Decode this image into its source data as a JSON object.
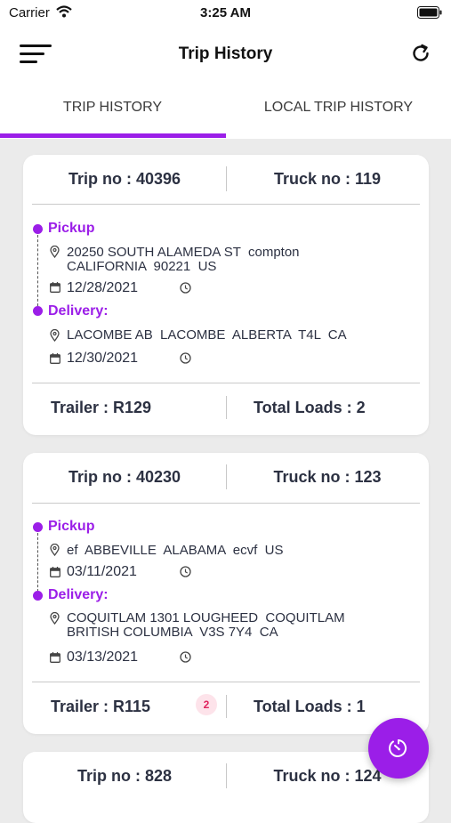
{
  "status_bar": {
    "carrier": "Carrier",
    "time": "3:25 AM"
  },
  "header": {
    "title": "Trip History"
  },
  "tabs": [
    {
      "label": "TRIP HISTORY",
      "active": true
    },
    {
      "label": "LOCAL TRIP HISTORY",
      "active": false
    }
  ],
  "colors": {
    "accent": "#9b1ee8",
    "badge_bg": "#fde3ea",
    "badge_text": "#e0245e",
    "text": "#2c3142"
  },
  "trips": [
    {
      "trip_no": "Trip no : 40396",
      "truck_no": "Truck no : 119",
      "pickup_label": "Pickup",
      "pickup_address": "20250 SOUTH ALAMEDA ST  compton\nCALIFORNIA  90221  US",
      "pickup_date": "12/28/2021",
      "delivery_label": "Delivery:",
      "delivery_address": "LACOMBE AB  LACOMBE  ALBERTA  T4L  CA",
      "delivery_date": "12/30/2021",
      "trailer": "Trailer : R129",
      "total_loads": "Total Loads : 2"
    },
    {
      "trip_no": "Trip no : 40230",
      "truck_no": "Truck no : 123",
      "pickup_label": "Pickup",
      "pickup_address": "ef  ABBEVILLE  ALABAMA  ecvf  US",
      "pickup_date": "03/11/2021",
      "delivery_label": "Delivery:",
      "delivery_address": "COQUITLAM 1301 LOUGHEED  COQUITLAM\nBRITISH COLUMBIA  V3S 7Y4  CA",
      "delivery_date": "03/13/2021",
      "trailer": "Trailer : R115",
      "badge": "2",
      "total_loads": "Total Loads : 1"
    },
    {
      "trip_no": "Trip no : 828",
      "truck_no": "Truck no : 124"
    }
  ],
  "icons": {
    "menu": "hamburger-icon",
    "refresh": "refresh-icon",
    "location": "location-pin-icon",
    "calendar": "calendar-icon",
    "clock": "clock-icon",
    "fab": "timer-icon"
  }
}
